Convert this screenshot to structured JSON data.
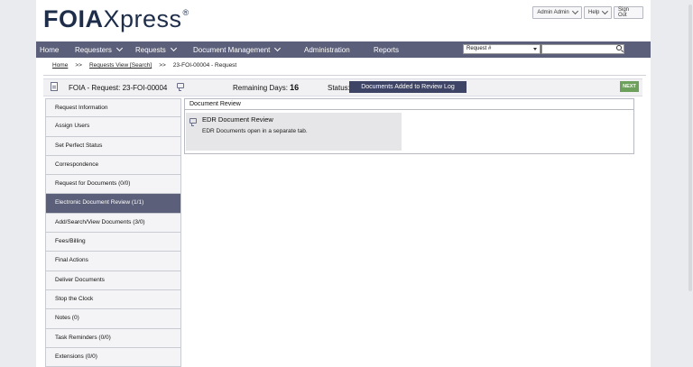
{
  "logo": {
    "bold": "FOIA",
    "light": "Xpress",
    "mark": "®"
  },
  "top_buttons": {
    "user": "Admin Admin",
    "help": "Help",
    "signout": "Sign Out"
  },
  "nav": {
    "home": "Home",
    "requesters": "Requesters",
    "requests": "Requests",
    "document_management": "Document Management",
    "administration": "Administration",
    "reports": "Reports"
  },
  "search": {
    "select_value": "Request #",
    "input_value": ""
  },
  "breadcrumb": {
    "home": "Home",
    "sep": ">>",
    "view": "Requests View [Search]",
    "current": "23-FOI-00004 - Request"
  },
  "request": {
    "title": "FOIA - Request: 23-FOI-00004",
    "remaining_label": "Remaining Days:",
    "remaining_value": "16",
    "status_label": "Status:",
    "status_value": "Documents Added to Review Log",
    "next_label": "NEXT"
  },
  "sidebar": {
    "items": [
      {
        "label": "Request Information"
      },
      {
        "label": "Assign Users"
      },
      {
        "label": "Set Perfect Status"
      },
      {
        "label": "Correspondence"
      },
      {
        "label": "Request for Documents (0/0)"
      },
      {
        "label": "Electronic Document Review (1/1)"
      },
      {
        "label": "Add/Search/View Documents (3/0)"
      },
      {
        "label": "Fees/Billing"
      },
      {
        "label": "Final Actions"
      },
      {
        "label": "Deliver Documents"
      },
      {
        "label": "Stop the Clock"
      },
      {
        "label": "Notes (0)"
      },
      {
        "label": "Task Reminders (0/0)"
      },
      {
        "label": "Extensions (0/0)"
      }
    ],
    "active_index": 5
  },
  "panel": {
    "header": "Document Review",
    "edr_title": "EDR Document Review",
    "edr_desc": "EDR Documents open in a separate tab."
  },
  "colors": {
    "nav": "#5b5f79",
    "status": "#3d4466",
    "next": "#6da05a"
  }
}
